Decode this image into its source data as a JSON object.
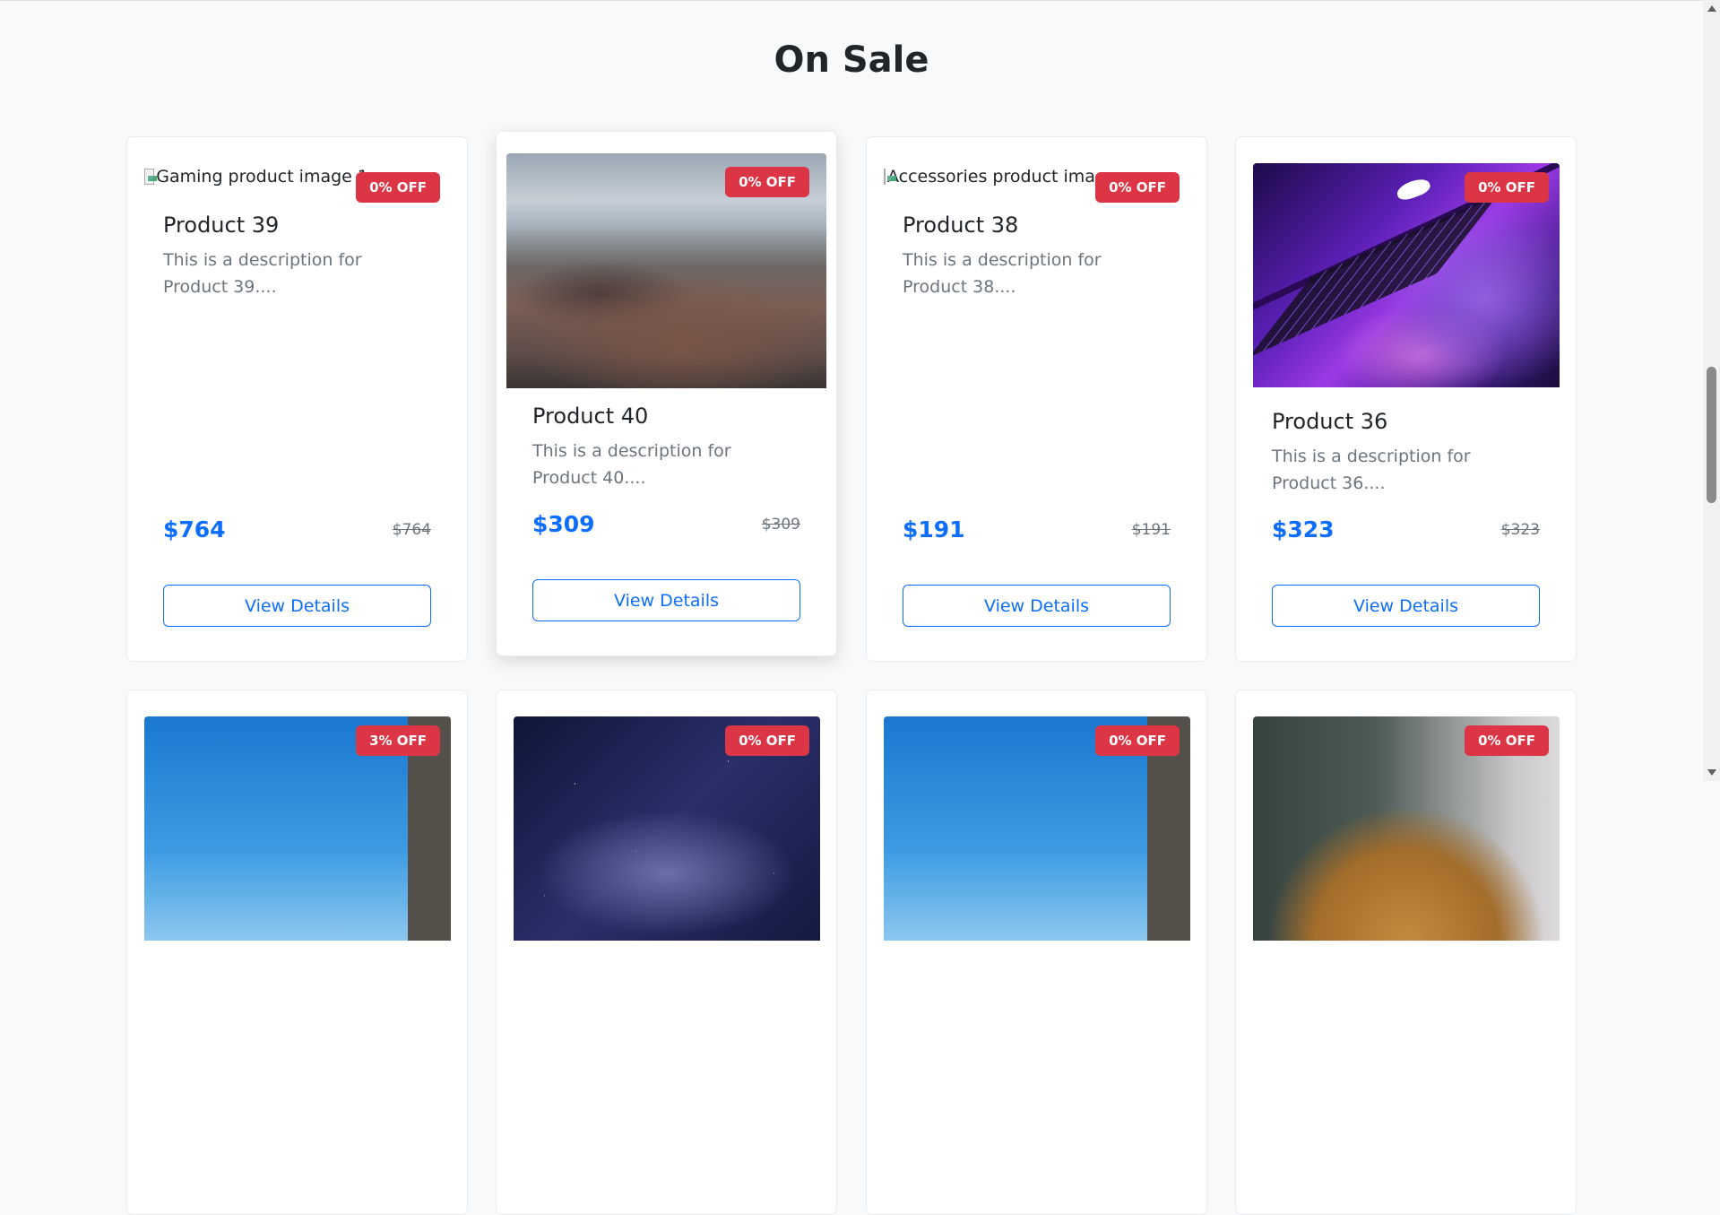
{
  "section": {
    "title": "On Sale"
  },
  "products": [
    {
      "name": "Product 39",
      "description": "This is a description for Product 39....",
      "price": "$764",
      "old_price": "$764",
      "discount": "0% OFF",
      "image_alt": "Gaming product image 1",
      "button": "View Details"
    },
    {
      "name": "Product 40",
      "description": "This is a description for Product 40....",
      "price": "$309",
      "old_price": "$309",
      "discount": "0% OFF",
      "button": "View Details"
    },
    {
      "name": "Product 38",
      "description": "This is a description for Product 38....",
      "price": "$191",
      "old_price": "$191",
      "discount": "0% OFF",
      "image_alt": "Accessories product image",
      "button": "View Details"
    },
    {
      "name": "Product 36",
      "description": "This is a description for Product 36....",
      "price": "$323",
      "old_price": "$323",
      "discount": "0% OFF",
      "button": "View Details"
    }
  ],
  "second_row": [
    {
      "discount": "3% OFF"
    },
    {
      "discount": "0% OFF"
    },
    {
      "discount": "0% OFF"
    },
    {
      "discount": "0% OFF"
    }
  ],
  "colors": {
    "accent": "#0d6efd",
    "badge": "#dc3545",
    "background": "#f8f9fa"
  }
}
